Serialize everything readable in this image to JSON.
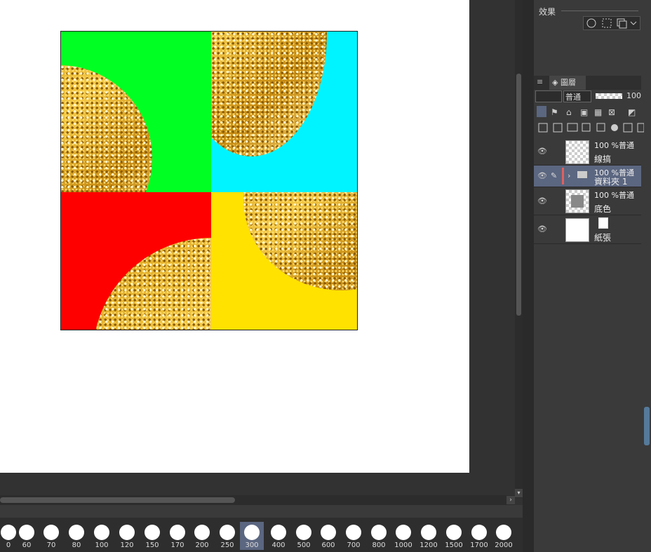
{
  "effect": {
    "label": "效果"
  },
  "layer_panel": {
    "tab_label": "圖層",
    "blend_mode": "普通",
    "opacity": "100"
  },
  "layers": [
    {
      "opacity_mode": "100 %普通",
      "name": "線搞"
    },
    {
      "opacity_mode": "100 %普通",
      "name": "資料夾 1"
    },
    {
      "opacity_mode": "100 %普通",
      "name": "底色"
    },
    {
      "opacity_mode": "",
      "name": "紙張"
    }
  ],
  "brush_sizes": [
    "0",
    "60",
    "70",
    "80",
    "100",
    "120",
    "150",
    "170",
    "200",
    "250",
    "300",
    "400",
    "500",
    "600",
    "700",
    "800",
    "1000",
    "1200",
    "1500",
    "1700",
    "2000"
  ],
  "selected_brush_size": "300",
  "colors": {
    "green": "#00ff22",
    "cyan": "#00f4ff",
    "red": "#ff0000",
    "yellow": "#ffe200"
  }
}
